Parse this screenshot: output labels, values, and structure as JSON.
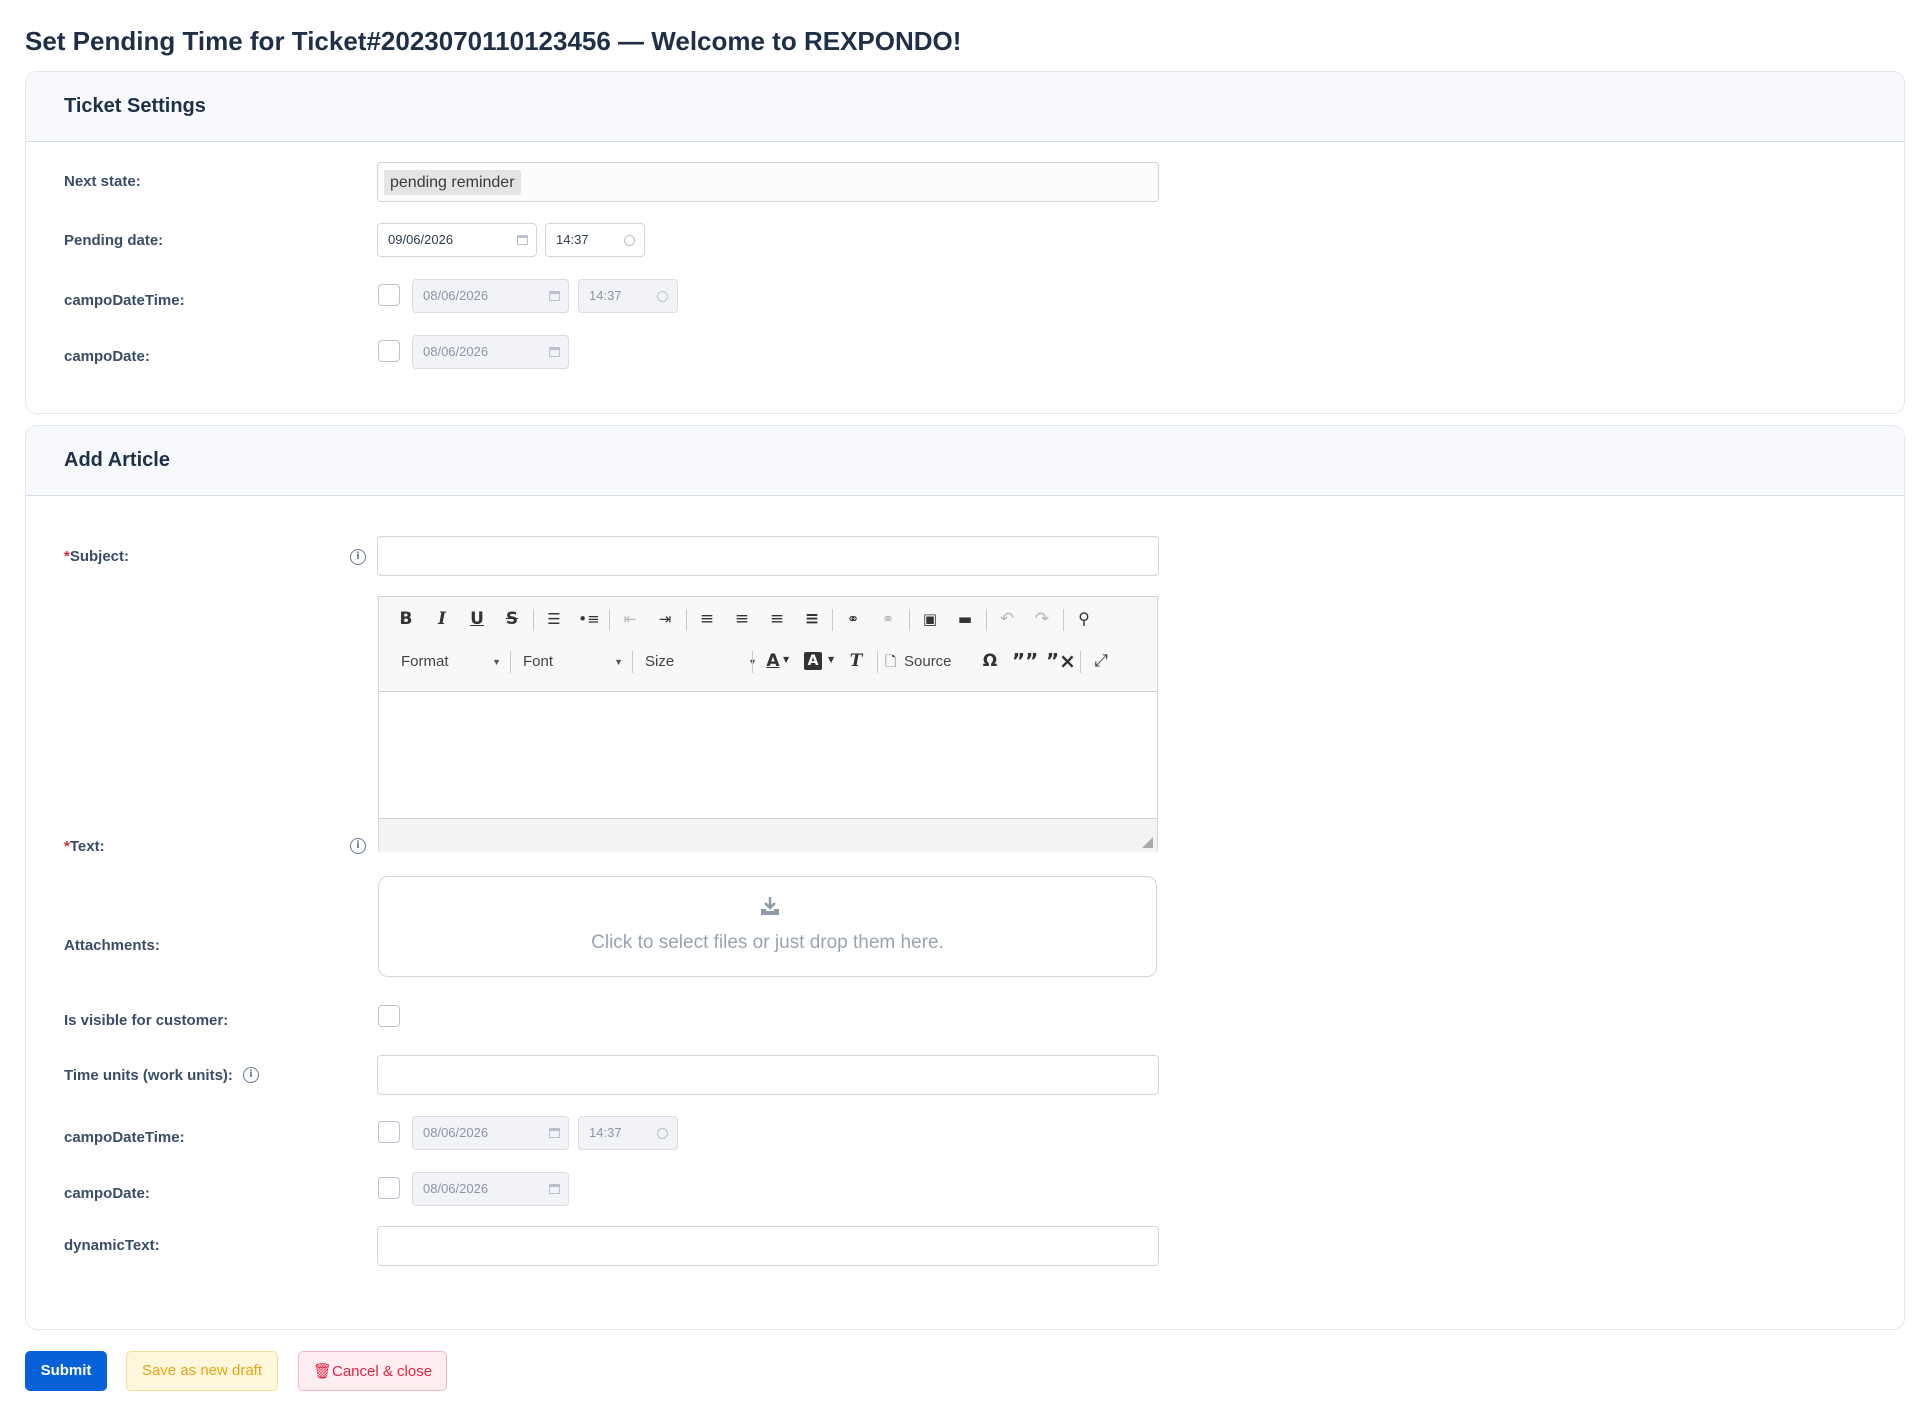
{
  "page": {
    "title": "Set Pending Time for Ticket#2023070110123456 — Welcome to REXPONDO!"
  },
  "ticket_settings": {
    "title": "Ticket Settings",
    "next_state": {
      "label": "Next state:",
      "value": "pending reminder"
    },
    "pending_date": {
      "label": "Pending date:",
      "date": "09/06/2026",
      "time": "14:37"
    },
    "campo_datetime": {
      "label": "campoDateTime:",
      "date": "08/06/2026",
      "time": "14:37",
      "checked": false
    },
    "campo_date": {
      "label": "campoDate:",
      "date": "08/06/2026",
      "checked": false
    }
  },
  "add_article": {
    "title": "Add Article",
    "required_mark": "*",
    "subject": {
      "label": "Subject:",
      "value": ""
    },
    "text": {
      "label": "Text:"
    },
    "editor": {
      "format_label": "Format",
      "font_label": "Font",
      "size_label": "Size",
      "source_label": "Source",
      "icons": {
        "bold": "B",
        "italic": "I",
        "underline": "U",
        "strike": "S",
        "omega": "Ω",
        "quote": "””",
        "text_color": "A",
        "bg_color": "A",
        "clear_format": "T"
      }
    },
    "attachments": {
      "label": "Attachments:",
      "placeholder": "Click to select files or just drop them here."
    },
    "visible_customer": {
      "label": "Is visible for customer:",
      "checked": false
    },
    "time_units": {
      "label": "Time units (work units):",
      "value": ""
    },
    "campo_datetime": {
      "label": "campoDateTime:",
      "date": "08/06/2026",
      "time": "14:37",
      "checked": false
    },
    "campo_date": {
      "label": "campoDate:",
      "date": "08/06/2026",
      "checked": false
    },
    "dynamic_text": {
      "label": "dynamicText:",
      "value": ""
    }
  },
  "actions": {
    "submit": "Submit",
    "save_draft": "Save as new draft",
    "cancel_close": "Cancel & close"
  },
  "colors": {
    "primary": "#0762d9",
    "warning": "#e6a417",
    "danger": "#e1243f",
    "required": "#e0243b"
  }
}
